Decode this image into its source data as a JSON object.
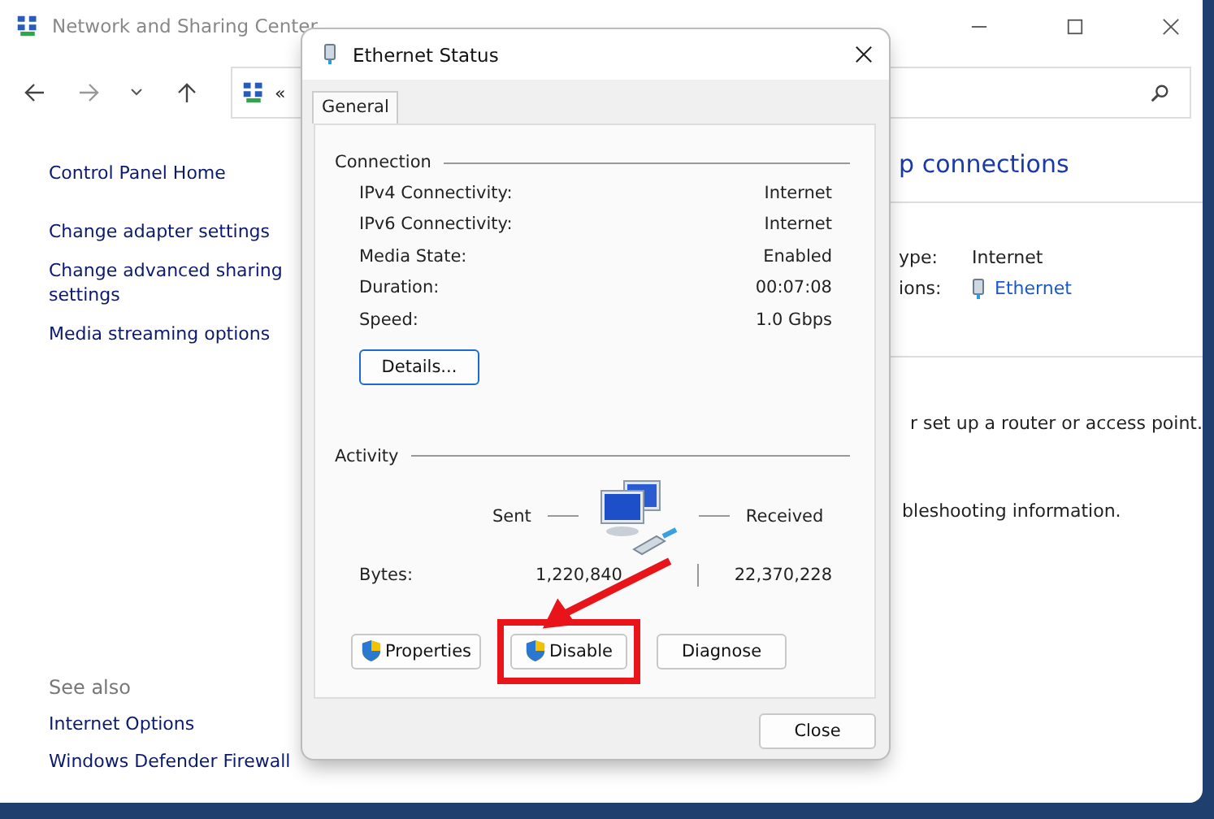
{
  "main_window": {
    "title": "Network and Sharing Center",
    "address_text": "«",
    "sidebar": {
      "links": [
        "Control Panel Home",
        "Change adapter settings",
        "Change advanced sharing settings",
        "Media streaming options"
      ],
      "see_also_heading": "See also",
      "see_also_links": [
        "Internet Options",
        "Windows Defender Firewall"
      ]
    },
    "content": {
      "heading": "p connections",
      "rows": [
        {
          "label": "ype:",
          "value": "Internet",
          "kind": "text"
        },
        {
          "label": "ions:",
          "value": "Ethernet",
          "kind": "link"
        }
      ],
      "texts": [
        "r set up a router or access point.",
        "bleshooting information."
      ]
    }
  },
  "dialog": {
    "title": "Ethernet Status",
    "tabs": [
      {
        "label": "General",
        "selected": true
      }
    ],
    "connection": {
      "heading": "Connection",
      "rows": [
        {
          "label": "IPv4 Connectivity:",
          "value": "Internet"
        },
        {
          "label": "IPv6 Connectivity:",
          "value": "Internet"
        },
        {
          "label": "Media State:",
          "value": "Enabled"
        },
        {
          "label": "Duration:",
          "value": "00:07:08"
        },
        {
          "label": "Speed:",
          "value": "1.0 Gbps"
        }
      ],
      "details_button": "Details..."
    },
    "activity": {
      "heading": "Activity",
      "sent_label": "Sent",
      "received_label": "Received",
      "bytes_label": "Bytes:",
      "sent": "1,220,840",
      "received": "22,370,228"
    },
    "buttons": [
      {
        "label": "Properties",
        "shield": true,
        "highlighted": false
      },
      {
        "label": "Disable",
        "shield": true,
        "highlighted": true
      },
      {
        "label": "Diagnose",
        "shield": false,
        "highlighted": false
      }
    ],
    "close_button": "Close"
  }
}
